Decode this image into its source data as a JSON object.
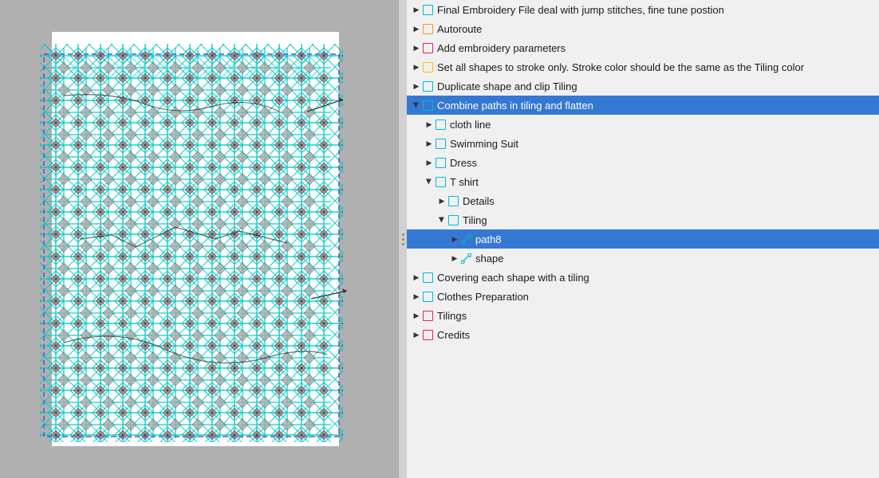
{
  "canvas": {
    "label": "canvas area"
  },
  "panel": {
    "items": [
      {
        "id": "final-embroidery",
        "indent": 0,
        "expanded": false,
        "icon": "cyan-rect",
        "label": "Final Embroidery File deal with jump stitches, fine tune postion"
      },
      {
        "id": "autoroute",
        "indent": 0,
        "expanded": false,
        "icon": "orange-rect",
        "label": "Autoroute"
      },
      {
        "id": "add-embroidery",
        "indent": 0,
        "expanded": false,
        "icon": "pink-rect",
        "label": "Add embroidery parameters"
      },
      {
        "id": "set-shapes",
        "indent": 0,
        "expanded": false,
        "icon": "yellow-rect",
        "label": "Set all shapes to stroke only.  Stroke color should be the same as the Tiling color"
      },
      {
        "id": "duplicate-shape",
        "indent": 0,
        "expanded": false,
        "icon": "cyan-rect",
        "label": "Duplicate shape and clip Tiling"
      },
      {
        "id": "combine-paths",
        "indent": 0,
        "expanded": true,
        "icon": "cyan-rect",
        "label": "Combine paths in tiling and  flatten",
        "selected": true
      },
      {
        "id": "cloth-line",
        "indent": 1,
        "expanded": false,
        "icon": "cyan-rect",
        "label": "cloth line"
      },
      {
        "id": "swimming-suit",
        "indent": 1,
        "expanded": false,
        "icon": "cyan-rect",
        "label": "Swimming Suit"
      },
      {
        "id": "dress",
        "indent": 1,
        "expanded": false,
        "icon": "cyan-rect",
        "label": "Dress"
      },
      {
        "id": "t-shirt",
        "indent": 1,
        "expanded": true,
        "icon": "cyan-rect",
        "label": "T shirt"
      },
      {
        "id": "details",
        "indent": 2,
        "expanded": false,
        "icon": "cyan-rect",
        "label": "Details"
      },
      {
        "id": "tiling",
        "indent": 2,
        "expanded": true,
        "icon": "cyan-rect",
        "label": "Tiling"
      },
      {
        "id": "path8",
        "indent": 3,
        "expanded": false,
        "icon": "path",
        "label": "path8",
        "selectedRow": true
      },
      {
        "id": "shape",
        "indent": 3,
        "expanded": false,
        "icon": "path",
        "label": "shape"
      },
      {
        "id": "covering",
        "indent": 0,
        "expanded": false,
        "icon": "cyan-rect",
        "label": "Covering each shape with a tiling"
      },
      {
        "id": "clothes-prep",
        "indent": 0,
        "expanded": false,
        "icon": "cyan-rect",
        "label": "Clothes  Preparation"
      },
      {
        "id": "tilings",
        "indent": 0,
        "expanded": false,
        "icon": "pink-rect",
        "label": "Tilings"
      },
      {
        "id": "credits",
        "indent": 0,
        "expanded": false,
        "icon": "pink-rect",
        "label": "Credits"
      }
    ]
  }
}
